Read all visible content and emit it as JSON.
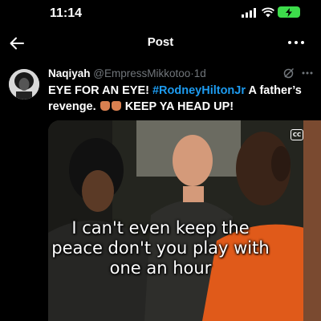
{
  "status_bar": {
    "time": "11:14",
    "battery_color": "#3ddc4b"
  },
  "nav": {
    "title": "Post",
    "back_icon": "arrow-left-icon",
    "more_icon": "more-horizontal-icon"
  },
  "tweet": {
    "author_name": "Naqiyah",
    "author_handle": "@EmpressMikkotoo",
    "separator": "·",
    "time": "1d",
    "text_start": "EYE FOR AN EYE! ",
    "hashtag": "#RodneyHiltonJr",
    "text_mid": " A father’s revenge. ",
    "text_end": " KEEP YA HEAD UP!",
    "hashtag_color": "#1d9bf0"
  },
  "media": {
    "cc_label": "CC",
    "caption_line1": "I can't even keep the",
    "caption_line2": "peace don't you play with",
    "caption_line3": "one an hour"
  }
}
